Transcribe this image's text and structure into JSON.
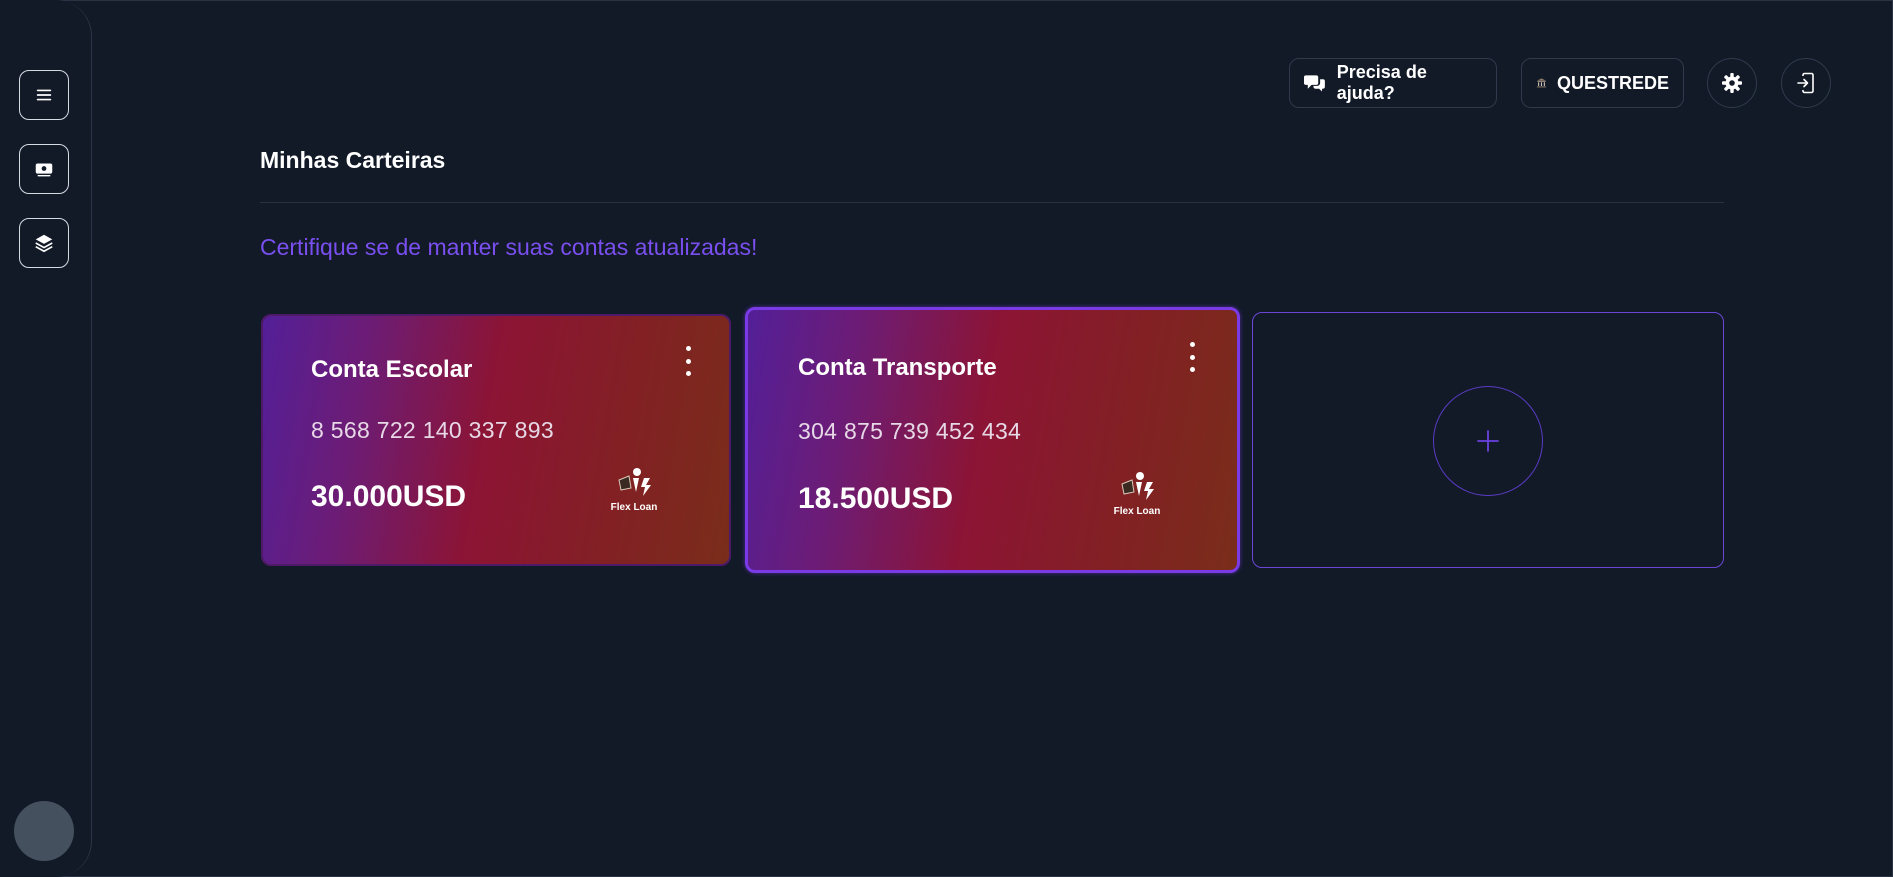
{
  "header": {
    "help_label": "Precisa de ajuda?",
    "bank_label": "QUESTREDE"
  },
  "sidebar": {
    "items": [
      {
        "icon": "menu-icon"
      },
      {
        "icon": "wallet-icon"
      },
      {
        "icon": "layers-icon"
      }
    ]
  },
  "main": {
    "title": "Minhas Carteiras",
    "subtitle": "Certifique se de manter suas contas atualizadas!",
    "cards": [
      {
        "name": "Conta Escolar",
        "number": "8 568 722 140 337 893",
        "amount": "30.000USD",
        "logo_text": "Flex Loan"
      },
      {
        "name": "Conta Transporte",
        "number": "304 875 739 452 434",
        "amount": "18.500USD",
        "logo_text": "Flex Loan"
      }
    ],
    "add_symbol": "+"
  },
  "colors": {
    "background": "#121a28",
    "accent": "#7a4ff0",
    "card_gradient_start": "#531f98",
    "card_gradient_mid": "#8c1434",
    "card_gradient_end": "#7a2d1a"
  }
}
